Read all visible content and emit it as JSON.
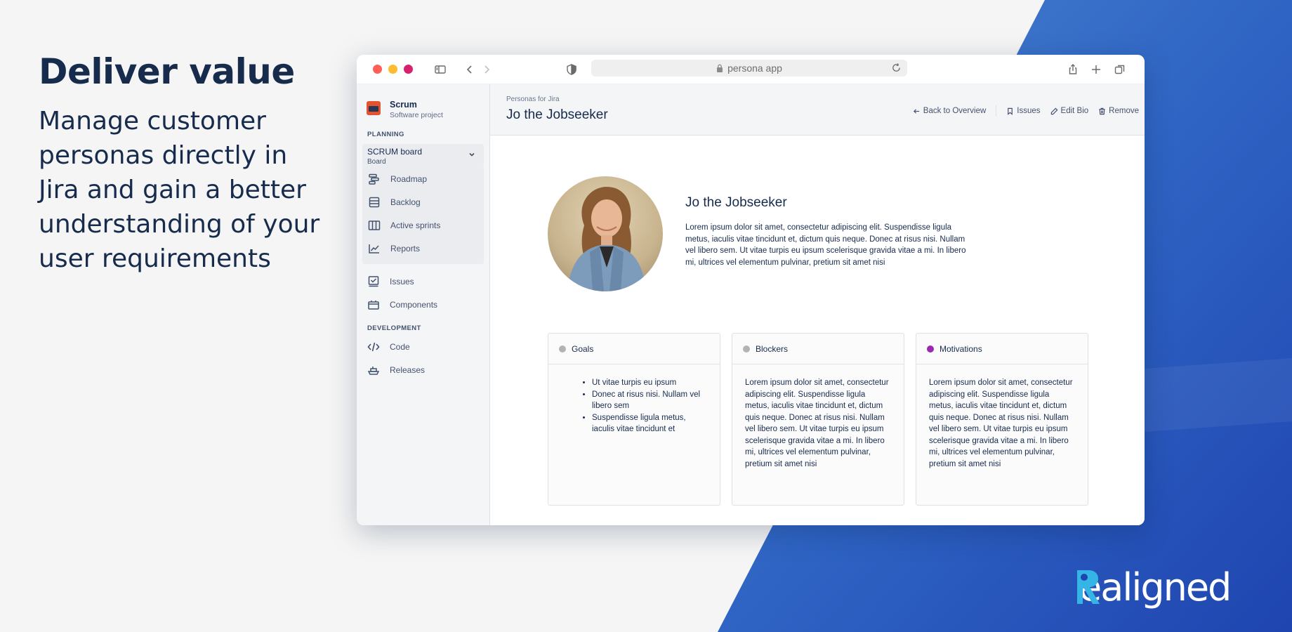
{
  "hero": {
    "title": "Deliver value",
    "subtitle": "Manage customer personas directly in Jira and gain a better understanding of your user requirements"
  },
  "browser": {
    "url": "persona app",
    "traffic_colors": [
      "#ff5f57",
      "#febc2e",
      "#d6226c"
    ]
  },
  "sidebar": {
    "project_name": "Scrum",
    "project_type": "Software project",
    "planning_heading": "PLANNING",
    "board_name": "SCRUM board",
    "board_type": "Board",
    "board_items": [
      {
        "label": "Roadmap",
        "icon": "roadmap-icon"
      },
      {
        "label": "Backlog",
        "icon": "backlog-icon"
      },
      {
        "label": "Active sprints",
        "icon": "columns-icon"
      },
      {
        "label": "Reports",
        "icon": "chart-line-icon"
      }
    ],
    "items": [
      {
        "label": "Issues",
        "icon": "checkbox-icon"
      },
      {
        "label": "Components",
        "icon": "components-icon"
      }
    ],
    "development_heading": "DEVELOPMENT",
    "dev_items": [
      {
        "label": "Code",
        "icon": "code-icon"
      },
      {
        "label": "Releases",
        "icon": "ship-icon"
      }
    ]
  },
  "header": {
    "breadcrumb": "Personas for Jira",
    "title": "Jo the Jobseeker",
    "back_label": "Back to Overview",
    "issues_label": "Issues",
    "edit_label": "Edit Bio",
    "remove_label": "Remove"
  },
  "persona": {
    "name": "Jo the Jobseeker",
    "bio": "Lorem ipsum dolor sit amet, consectetur adipiscing elit. Suspendisse ligula metus, iaculis vitae tincidunt et, dictum quis neque. Donec at risus nisi. Nullam vel libero sem. Ut vitae turpis eu ipsum scelerisque gravida vitae a mi. In libero mi, ultrices vel elementum pulvinar, pretium sit amet nisi"
  },
  "cards": {
    "goals": {
      "title": "Goals",
      "color": "#b3b3b3",
      "items": [
        "Ut vitae turpis eu ipsum",
        "Donec at risus nisi. Nullam vel libero sem",
        "Suspendisse ligula metus, iaculis vitae tincidunt et"
      ]
    },
    "blockers": {
      "title": "Blockers",
      "color": "#b3b3b3",
      "text": "Lorem ipsum dolor sit amet, consectetur adipiscing elit. Suspendisse ligula metus, iaculis vitae tincidunt et, dictum quis neque. Donec at risus nisi. Nullam vel libero sem. Ut vitae turpis eu ipsum scelerisque gravida vitae a mi. In libero mi, ultrices vel elementum pulvinar, pretium sit amet nisi"
    },
    "motivations": {
      "title": "Motivations",
      "color": "#9c27b0",
      "text": "Lorem ipsum dolor sit amet, consectetur adipiscing elit. Suspendisse ligula metus, iaculis vitae tincidunt et, dictum quis neque. Donec at risus nisi. Nullam vel libero sem. Ut vitae turpis eu ipsum scelerisque gravida vitae a mi. In libero mi, ultrices vel elementum pulvinar, pretium sit amet nisi"
    }
  },
  "brand": {
    "logo_text": "Realigned",
    "background_blue": "#2d5fc0"
  }
}
